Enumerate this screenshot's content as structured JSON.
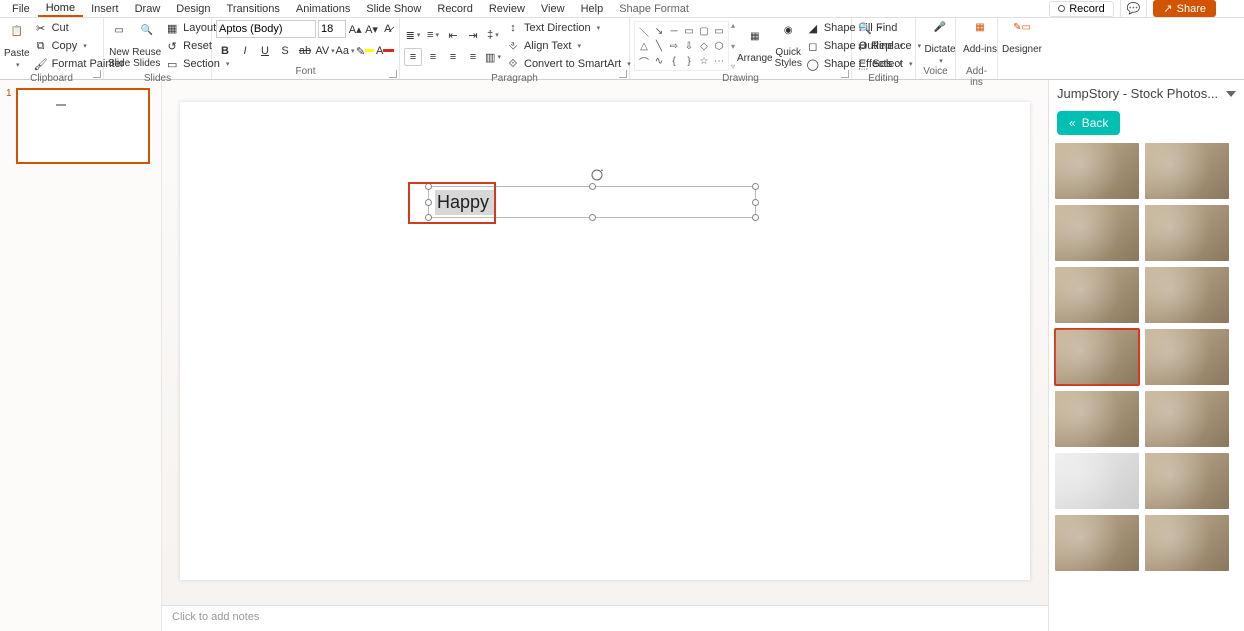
{
  "tabs": {
    "file": "File",
    "home": "Home",
    "insert": "Insert",
    "draw": "Draw",
    "design": "Design",
    "transitions": "Transitions",
    "animations": "Animations",
    "slideshow": "Slide Show",
    "record": "Record",
    "review": "Review",
    "view": "View",
    "help": "Help",
    "shapeformat": "Shape Format"
  },
  "titlebar": {
    "record": "Record",
    "share": "Share"
  },
  "ribbon": {
    "clipboard": {
      "paste": "Paste",
      "cut": "Cut",
      "copy": "Copy",
      "fp": "Format Painter",
      "label": "Clipboard"
    },
    "slides": {
      "new": "New\nSlide",
      "reuse": "Reuse\nSlides",
      "layout": "Layout",
      "reset": "Reset",
      "section": "Section",
      "label": "Slides"
    },
    "font": {
      "name": "Aptos (Body)",
      "size": "18",
      "label": "Font"
    },
    "paragraph": {
      "td": "Text Direction",
      "at": "Align Text",
      "smart": "Convert to SmartArt",
      "label": "Paragraph"
    },
    "drawing": {
      "arrange": "Arrange",
      "qs": "Quick\nStyles",
      "fill": "Shape Fill",
      "outline": "Shape Outline",
      "effects": "Shape Effects",
      "label": "Drawing"
    },
    "editing": {
      "find": "Find",
      "replace": "Replace",
      "select": "Select",
      "label": "Editing"
    },
    "voice": {
      "dictate": "Dictate",
      "label": "Voice"
    },
    "addins": {
      "addins": "Add-ins",
      "label": "Add-ins"
    },
    "designer": {
      "designer": "Designer"
    }
  },
  "thumb": {
    "num": "1"
  },
  "textbox": {
    "text": "Happy"
  },
  "notes": {
    "placeholder": "Click to add notes"
  },
  "panel": {
    "title": "JumpStory - Stock Photos...",
    "back": "Back"
  }
}
